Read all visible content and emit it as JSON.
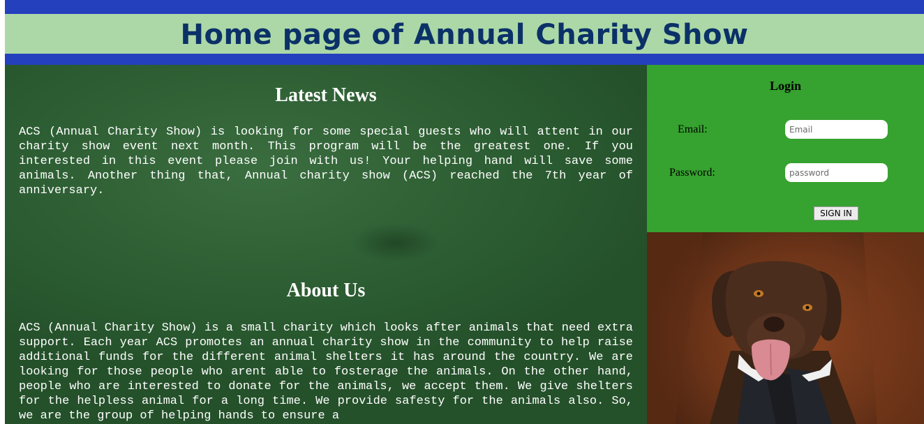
{
  "header": {
    "title": "Home page of Annual Charity Show"
  },
  "news": {
    "title": "Latest News",
    "text": "ACS (Annual Charity Show) is looking for some special guests who will attent in our charity show event next month. This program will be the greatest one. If you interested in this event please join with us! Your helping hand will save some animals. Another thing that, Annual charity show (ACS) reached the 7th year of anniversary."
  },
  "about": {
    "title": "About Us",
    "text": "ACS (Annual Charity Show) is a small charity which looks after animals that need extra support. Each year ACS promotes an annual charity show in the community to help raise additional funds for the different animal shelters it has around the country. We are looking for those people who arent able to fosterage the animals. On the other hand, people who are interested to donate for the animals, we accept them. We give shelters for the helpless animal for a long time. We provide safesty for the animals also. So, we are the group of helping hands to ensure a"
  },
  "login": {
    "title": "Login",
    "email_label": "Email:",
    "email_placeholder": "Email",
    "password_label": "Password:",
    "password_placeholder": "password",
    "signin_label": "SIGN IN"
  },
  "colors": {
    "bar_blue": "#2440bd",
    "header_green": "#acd8a7",
    "title_navy": "#0b3168",
    "login_green": "#36a22f",
    "main_green": "#2f5f34"
  }
}
